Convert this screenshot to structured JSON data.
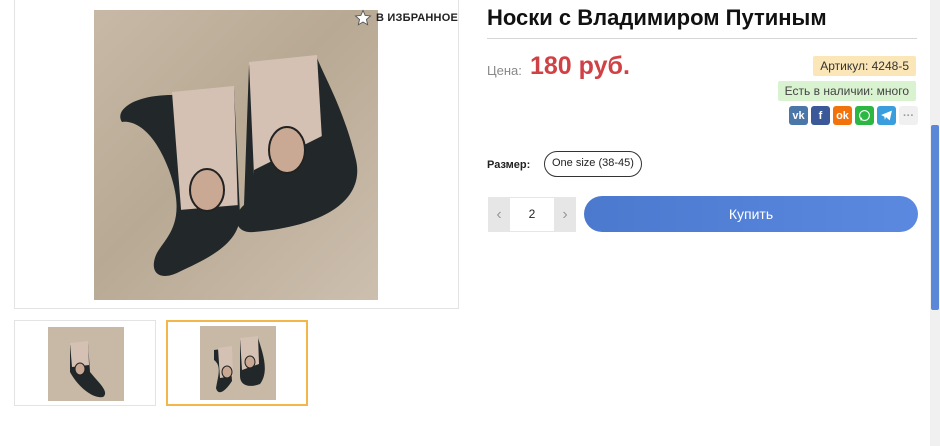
{
  "favorite": {
    "label": "В ИЗБРАННОЕ"
  },
  "product": {
    "title": "Носки с Владимиром Путиным",
    "price_label": "Цена:",
    "price_value": "180 руб.",
    "article": "Артикул:  4248-5",
    "stock": "Есть в наличии: много"
  },
  "social": {
    "vk": "vk",
    "fb": "f",
    "ok": "ok",
    "more": "···"
  },
  "size": {
    "label": "Размер:",
    "option": "One size (38-45)"
  },
  "quantity": {
    "value": "2",
    "minus": "‹",
    "plus": "›"
  },
  "buy_button": {
    "label": "Купить"
  },
  "colors": {
    "accent": "#4b79ce",
    "price": "#d04146",
    "thumb_active": "#f3b64b"
  }
}
